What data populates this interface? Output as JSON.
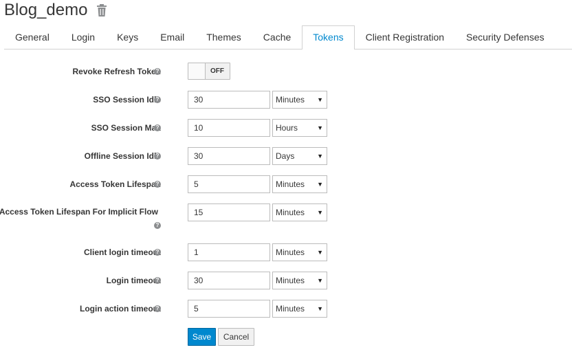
{
  "header": {
    "title": "Blog_demo",
    "delete_icon": "trash-icon"
  },
  "tabs": [
    {
      "label": "General"
    },
    {
      "label": "Login"
    },
    {
      "label": "Keys"
    },
    {
      "label": "Email"
    },
    {
      "label": "Themes"
    },
    {
      "label": "Cache"
    },
    {
      "label": "Tokens"
    },
    {
      "label": "Client Registration"
    },
    {
      "label": "Security Defenses"
    }
  ],
  "active_tab": "Tokens",
  "form": {
    "revoke_refresh_token": {
      "label": "Revoke Refresh Token",
      "toggle_text": "OFF"
    },
    "fields": [
      {
        "label": "SSO Session Idle",
        "value": "30",
        "unit": "Minutes"
      },
      {
        "label": "SSO Session Max",
        "value": "10",
        "unit": "Hours"
      },
      {
        "label": "Offline Session Idle",
        "value": "30",
        "unit": "Days"
      },
      {
        "label": "Access Token Lifespan",
        "value": "5",
        "unit": "Minutes"
      },
      {
        "label": "Access Token Lifespan For Implicit Flow",
        "value": "15",
        "unit": "Minutes"
      },
      {
        "label": "Client login timeout",
        "value": "1",
        "unit": "Minutes"
      },
      {
        "label": "Login timeout",
        "value": "30",
        "unit": "Minutes"
      },
      {
        "label": "Login action timeout",
        "value": "5",
        "unit": "Minutes"
      }
    ],
    "help_icon": "?",
    "select_arrow": "▼"
  },
  "buttons": {
    "save": "Save",
    "cancel": "Cancel"
  },
  "colors": {
    "accent": "#0088ce",
    "text": "#363636",
    "border": "#bbbbbb"
  }
}
